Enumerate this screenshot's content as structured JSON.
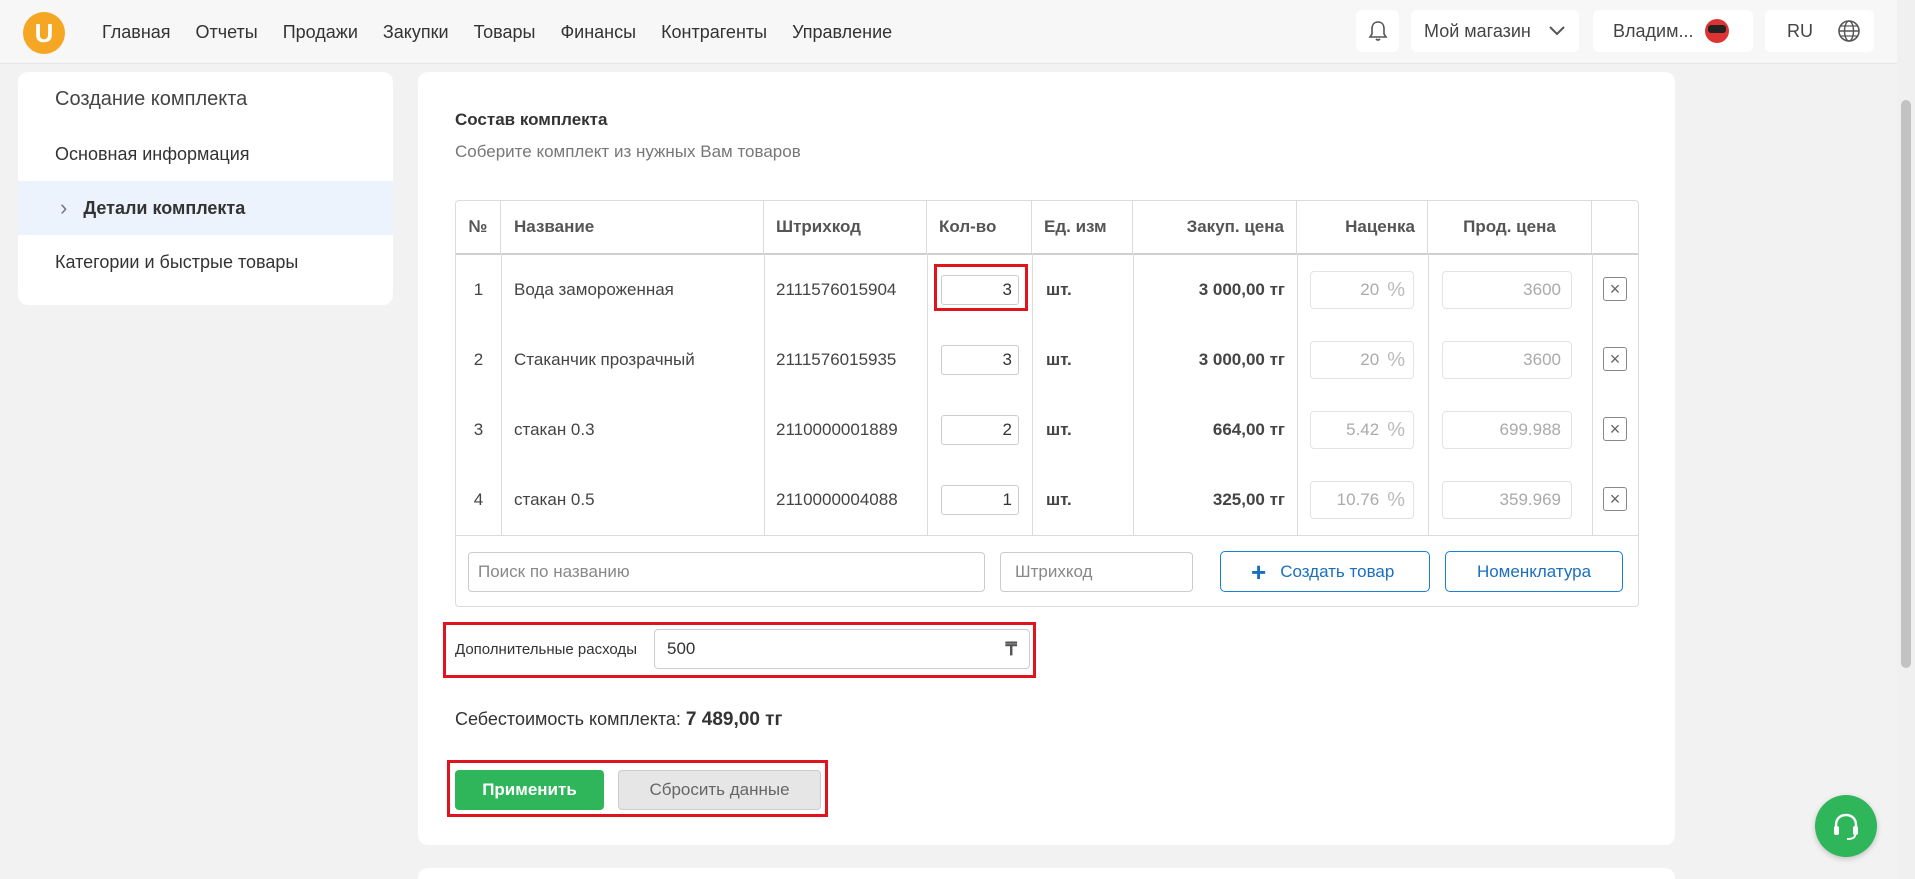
{
  "logo": {
    "letter": "U"
  },
  "nav": [
    "Главная",
    "Отчеты",
    "Продажи",
    "Закупки",
    "Товары",
    "Финансы",
    "Контрагенты",
    "Управление"
  ],
  "header": {
    "store": "Мой магазин",
    "user": "Владим...",
    "lang": "RU"
  },
  "sidebar": {
    "title": "Создание комплекта",
    "items": [
      {
        "label": "Основная информация"
      },
      {
        "label": "Детали комплекта"
      },
      {
        "label": "Категории и быстрые товары"
      }
    ]
  },
  "section": {
    "title": "Состав комплекта",
    "subtitle": "Соберите комплект из нужных Вам товаров"
  },
  "table": {
    "headers": {
      "num": "№",
      "name": "Название",
      "barcode": "Штрихкод",
      "qty": "Кол-во",
      "unit": "Ед. изм",
      "cost": "Закуп. цена",
      "markup": "Наценка",
      "price": "Прод. цена"
    },
    "rows": [
      {
        "num": "1",
        "name": "Вода замороженная",
        "barcode": "2111576015904",
        "qty": "3",
        "unit": "шт.",
        "cost": "3 000,00 тг",
        "markup": "20",
        "price": "3600"
      },
      {
        "num": "2",
        "name": "Стаканчик прозрачный",
        "barcode": "2111576015935",
        "qty": "3",
        "unit": "шт.",
        "cost": "3 000,00 тг",
        "markup": "20",
        "price": "3600"
      },
      {
        "num": "3",
        "name": "стакан 0.3",
        "barcode": "2110000001889",
        "qty": "2",
        "unit": "шт.",
        "cost": "664,00 тг",
        "markup": "5.42",
        "price": "699.988"
      },
      {
        "num": "4",
        "name": "стакан 0.5",
        "barcode": "2110000004088",
        "qty": "1",
        "unit": "шт.",
        "cost": "325,00 тг",
        "markup": "10.76",
        "price": "359.969"
      }
    ],
    "percent_sign": "%"
  },
  "footer": {
    "search_placeholder": "Поиск по названию",
    "barcode_placeholder": "Штрихкод",
    "create_label": "Создать товар",
    "nomenclature_label": "Номенклатура"
  },
  "extra": {
    "label": "Дополнительные расходы",
    "value": "500",
    "currency": "₸"
  },
  "cost": {
    "label": "Себестоимость комплекта:",
    "value": "7 489,00 тг"
  },
  "buttons": {
    "apply": "Применить",
    "reset": "Сбросить данные"
  },
  "colors": {
    "accent": "#1a7fd4",
    "green": "#2fb55a",
    "highlight": "#e0141f",
    "logo": "#f5a623"
  }
}
